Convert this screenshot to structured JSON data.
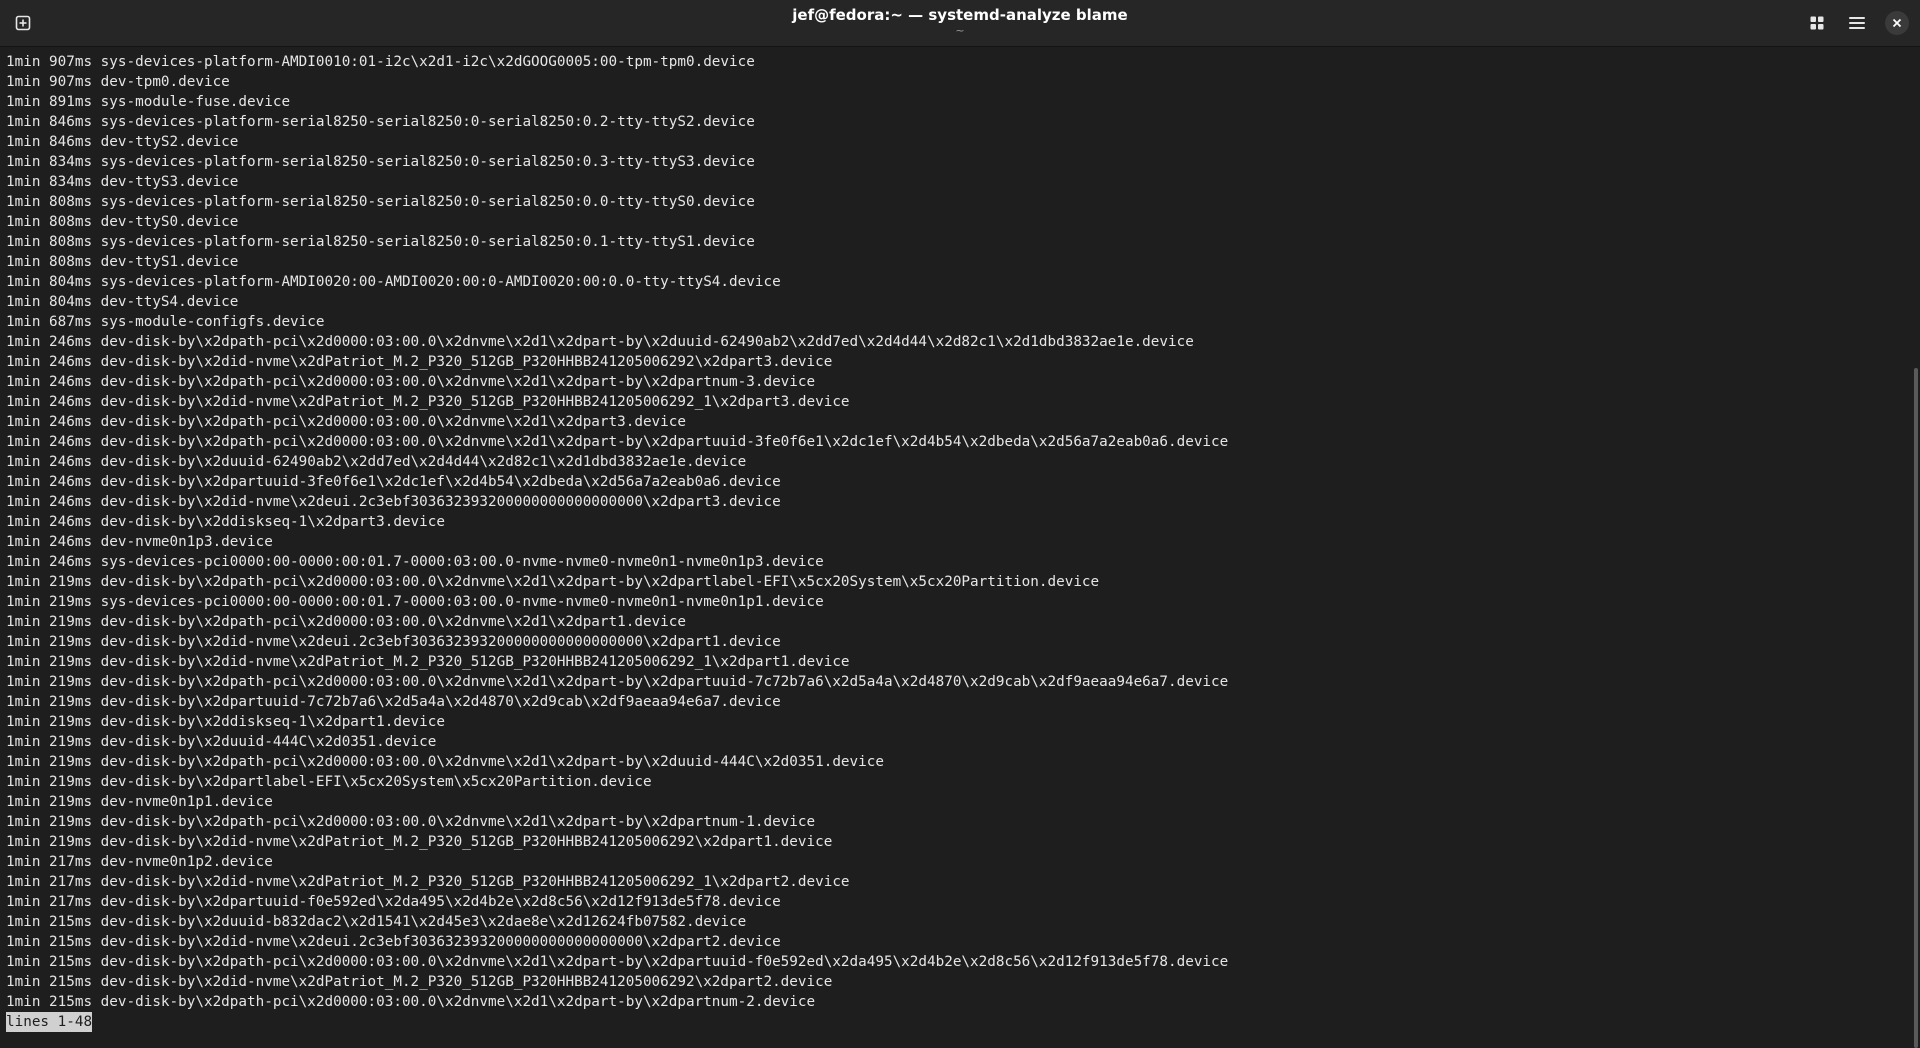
{
  "window": {
    "title": "jef@fedora:~ — systemd-analyze blame",
    "subtitle": "~"
  },
  "titlebar_icons": {
    "new_tab": "new-tab-icon",
    "view": "grid-view-icon",
    "menu": "hamburger-menu-icon",
    "close": "close-icon"
  },
  "terminal": {
    "lines": [
      "1min 907ms sys-devices-platform-AMDI0010:01-i2c\\x2d1-i2c\\x2dGOOG0005:00-tpm-tpm0.device",
      "1min 907ms dev-tpm0.device",
      "1min 891ms sys-module-fuse.device",
      "1min 846ms sys-devices-platform-serial8250-serial8250:0-serial8250:0.2-tty-ttyS2.device",
      "1min 846ms dev-ttyS2.device",
      "1min 834ms sys-devices-platform-serial8250-serial8250:0-serial8250:0.3-tty-ttyS3.device",
      "1min 834ms dev-ttyS3.device",
      "1min 808ms sys-devices-platform-serial8250-serial8250:0-serial8250:0.0-tty-ttyS0.device",
      "1min 808ms dev-ttyS0.device",
      "1min 808ms sys-devices-platform-serial8250-serial8250:0-serial8250:0.1-tty-ttyS1.device",
      "1min 808ms dev-ttyS1.device",
      "1min 804ms sys-devices-platform-AMDI0020:00-AMDI0020:00:0-AMDI0020:00:0.0-tty-ttyS4.device",
      "1min 804ms dev-ttyS4.device",
      "1min 687ms sys-module-configfs.device",
      "1min 246ms dev-disk-by\\x2dpath-pci\\x2d0000:03:00.0\\x2dnvme\\x2d1\\x2dpart-by\\x2duuid-62490ab2\\x2dd7ed\\x2d4d44\\x2d82c1\\x2d1dbd3832ae1e.device",
      "1min 246ms dev-disk-by\\x2did-nvme\\x2dPatriot_M.2_P320_512GB_P320HHBB241205006292\\x2dpart3.device",
      "1min 246ms dev-disk-by\\x2dpath-pci\\x2d0000:03:00.0\\x2dnvme\\x2d1\\x2dpart-by\\x2dpartnum-3.device",
      "1min 246ms dev-disk-by\\x2did-nvme\\x2dPatriot_M.2_P320_512GB_P320HHBB241205006292_1\\x2dpart3.device",
      "1min 246ms dev-disk-by\\x2dpath-pci\\x2d0000:03:00.0\\x2dnvme\\x2d1\\x2dpart3.device",
      "1min 246ms dev-disk-by\\x2dpath-pci\\x2d0000:03:00.0\\x2dnvme\\x2d1\\x2dpart-by\\x2dpartuuid-3fe0f6e1\\x2dc1ef\\x2d4b54\\x2dbeda\\x2d56a7a2eab0a6.device",
      "1min 246ms dev-disk-by\\x2duuid-62490ab2\\x2dd7ed\\x2d4d44\\x2d82c1\\x2d1dbd3832ae1e.device",
      "1min 246ms dev-disk-by\\x2dpartuuid-3fe0f6e1\\x2dc1ef\\x2d4b54\\x2dbeda\\x2d56a7a2eab0a6.device",
      "1min 246ms dev-disk-by\\x2did-nvme\\x2deui.2c3ebf303632393200000000000000000\\x2dpart3.device",
      "1min 246ms dev-disk-by\\x2ddiskseq-1\\x2dpart3.device",
      "1min 246ms dev-nvme0n1p3.device",
      "1min 246ms sys-devices-pci0000:00-0000:00:01.7-0000:03:00.0-nvme-nvme0-nvme0n1-nvme0n1p3.device",
      "1min 219ms dev-disk-by\\x2dpath-pci\\x2d0000:03:00.0\\x2dnvme\\x2d1\\x2dpart-by\\x2dpartlabel-EFI\\x5cx20System\\x5cx20Partition.device",
      "1min 219ms sys-devices-pci0000:00-0000:00:01.7-0000:03:00.0-nvme-nvme0-nvme0n1-nvme0n1p1.device",
      "1min 219ms dev-disk-by\\x2dpath-pci\\x2d0000:03:00.0\\x2dnvme\\x2d1\\x2dpart1.device",
      "1min 219ms dev-disk-by\\x2did-nvme\\x2deui.2c3ebf303632393200000000000000000\\x2dpart1.device",
      "1min 219ms dev-disk-by\\x2did-nvme\\x2dPatriot_M.2_P320_512GB_P320HHBB241205006292_1\\x2dpart1.device",
      "1min 219ms dev-disk-by\\x2dpath-pci\\x2d0000:03:00.0\\x2dnvme\\x2d1\\x2dpart-by\\x2dpartuuid-7c72b7a6\\x2d5a4a\\x2d4870\\x2d9cab\\x2df9aeaa94e6a7.device",
      "1min 219ms dev-disk-by\\x2dpartuuid-7c72b7a6\\x2d5a4a\\x2d4870\\x2d9cab\\x2df9aeaa94e6a7.device",
      "1min 219ms dev-disk-by\\x2ddiskseq-1\\x2dpart1.device",
      "1min 219ms dev-disk-by\\x2duuid-444C\\x2d0351.device",
      "1min 219ms dev-disk-by\\x2dpath-pci\\x2d0000:03:00.0\\x2dnvme\\x2d1\\x2dpart-by\\x2duuid-444C\\x2d0351.device",
      "1min 219ms dev-disk-by\\x2dpartlabel-EFI\\x5cx20System\\x5cx20Partition.device",
      "1min 219ms dev-nvme0n1p1.device",
      "1min 219ms dev-disk-by\\x2dpath-pci\\x2d0000:03:00.0\\x2dnvme\\x2d1\\x2dpart-by\\x2dpartnum-1.device",
      "1min 219ms dev-disk-by\\x2did-nvme\\x2dPatriot_M.2_P320_512GB_P320HHBB241205006292\\x2dpart1.device",
      "1min 217ms dev-nvme0n1p2.device",
      "1min 217ms dev-disk-by\\x2did-nvme\\x2dPatriot_M.2_P320_512GB_P320HHBB241205006292_1\\x2dpart2.device",
      "1min 217ms dev-disk-by\\x2dpartuuid-f0e592ed\\x2da495\\x2d4b2e\\x2d8c56\\x2d12f913de5f78.device",
      "1min 215ms dev-disk-by\\x2duuid-b832dac2\\x2d1541\\x2d45e3\\x2dae8e\\x2d12624fb07582.device",
      "1min 215ms dev-disk-by\\x2did-nvme\\x2deui.2c3ebf303632393200000000000000000\\x2dpart2.device",
      "1min 215ms dev-disk-by\\x2dpath-pci\\x2d0000:03:00.0\\x2dnvme\\x2d1\\x2dpart-by\\x2dpartuuid-f0e592ed\\x2da495\\x2d4b2e\\x2d8c56\\x2d12f913de5f78.device",
      "1min 215ms dev-disk-by\\x2did-nvme\\x2dPatriot_M.2_P320_512GB_P320HHBB241205006292\\x2dpart2.device",
      "1min 215ms dev-disk-by\\x2dpath-pci\\x2d0000:03:00.0\\x2dnvme\\x2d1\\x2dpart-by\\x2dpartnum-2.device"
    ],
    "status_line": "lines 1-48"
  },
  "colors": {
    "background": "#1e1e1e",
    "titlebar": "#262626",
    "text": "#e6e6e6",
    "status_bg": "#d0d0d0"
  }
}
